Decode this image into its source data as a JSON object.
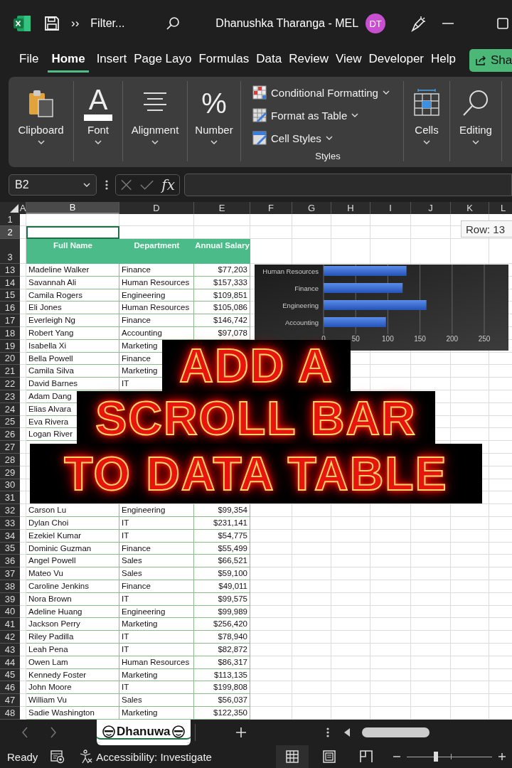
{
  "title_bar": {
    "more": "››",
    "document": "Filter...",
    "user": "Dhanushka Tharanga - MEL",
    "avatar": "DT"
  },
  "menu_tabs": [
    {
      "label": "File",
      "selected": false
    },
    {
      "label": "Home",
      "selected": true
    },
    {
      "label": "Insert",
      "selected": false
    },
    {
      "label": "Page Layo",
      "selected": false
    },
    {
      "label": "Formulas",
      "selected": false
    },
    {
      "label": "Data",
      "selected": false
    },
    {
      "label": "Review",
      "selected": false
    },
    {
      "label": "View",
      "selected": false
    },
    {
      "label": "Developer",
      "selected": false
    },
    {
      "label": "Help",
      "selected": false
    }
  ],
  "share_button": "Sha",
  "ribbon": {
    "groups": [
      {
        "kind": "clipboard",
        "label": "Clipboard"
      },
      {
        "kind": "font",
        "label": "Font",
        "glyph": "A"
      },
      {
        "kind": "alignment",
        "label": "Alignment"
      },
      {
        "kind": "number",
        "label": "Number",
        "glyph": "%"
      },
      {
        "kind": "styles",
        "label": "Styles",
        "items": [
          "Conditional Formatting",
          "Format as Table",
          "Cell Styles"
        ]
      },
      {
        "kind": "cells",
        "label": "Cells"
      },
      {
        "kind": "editing",
        "label": "Editing"
      }
    ]
  },
  "formula_bar": {
    "name_box": "B2",
    "function_label": "fx"
  },
  "sheet": {
    "columns": [
      {
        "label": "A",
        "selected": false
      },
      {
        "label": "B",
        "selected": true
      },
      {
        "label": "D",
        "selected": false
      },
      {
        "label": "E",
        "selected": false
      },
      {
        "label": "F",
        "selected": false
      },
      {
        "label": "G",
        "selected": false
      },
      {
        "label": "H",
        "selected": false
      },
      {
        "label": "I",
        "selected": false
      },
      {
        "label": "J",
        "selected": false
      },
      {
        "label": "K",
        "selected": false
      },
      {
        "label": "L",
        "selected": false
      }
    ],
    "top_rows": [
      {
        "number": "1",
        "selected": false
      },
      {
        "number": "2",
        "selected": true
      },
      {
        "number": "3",
        "selected": false
      }
    ],
    "row_tooltip": "Row: 13"
  },
  "table": {
    "columns": [
      "Full Name",
      "Department",
      "Annual Salary"
    ],
    "rows": [
      {
        "number": "13",
        "cells": [
          "Madeline Walker",
          "Finance",
          "$77,203"
        ]
      },
      {
        "number": "14",
        "cells": [
          "Savannah Ali",
          "Human Resources",
          "$157,333"
        ]
      },
      {
        "number": "15",
        "cells": [
          "Camila Rogers",
          "Engineering",
          "$109,851"
        ]
      },
      {
        "number": "16",
        "cells": [
          "Eli Jones",
          "Human Resources",
          "$105,086"
        ]
      },
      {
        "number": "17",
        "cells": [
          "Everleigh Ng",
          "Finance",
          "$146,742"
        ]
      },
      {
        "number": "18",
        "cells": [
          "Robert Yang",
          "Accounting",
          "$97,078"
        ]
      },
      {
        "number": "19",
        "cells": [
          "Isabella Xi",
          "Marketing"
        ]
      },
      {
        "number": "20",
        "cells": [
          "Bella Powell",
          "Finance"
        ]
      },
      {
        "number": "21",
        "cells": [
          "Camila Silva",
          "Marketing"
        ]
      },
      {
        "number": "22",
        "cells": [
          "David Barnes",
          "IT"
        ]
      },
      {
        "number": "23",
        "cells": [
          "Adam Dang"
        ]
      },
      {
        "number": "24",
        "cells": [
          "Elias Alvara"
        ]
      },
      {
        "number": "25",
        "cells": [
          "Eva Rivera"
        ]
      },
      {
        "number": "26",
        "cells": [
          "Logan River"
        ]
      },
      {
        "number": "27"
      },
      {
        "number": "28"
      },
      {
        "number": "29"
      },
      {
        "number": "30"
      },
      {
        "number": "31"
      },
      {
        "number": "32",
        "cells": [
          "Carson Lu",
          "Engineering",
          "$99,354"
        ]
      },
      {
        "number": "33",
        "cells": [
          "Dylan Choi",
          "IT",
          "$231,141"
        ]
      },
      {
        "number": "34",
        "cells": [
          "Ezekiel Kumar",
          "IT",
          "$54,775"
        ]
      },
      {
        "number": "35",
        "cells": [
          "Dominic Guzman",
          "Finance",
          "$55,499"
        ]
      },
      {
        "number": "36",
        "cells": [
          "Angel Powell",
          "Sales",
          "$66,521"
        ]
      },
      {
        "number": "37",
        "cells": [
          "Mateo Vu",
          "Sales",
          "$59,100"
        ]
      },
      {
        "number": "38",
        "cells": [
          "Caroline Jenkins",
          "Finance",
          "$49,011"
        ]
      },
      {
        "number": "39",
        "cells": [
          "Nora Brown",
          "IT",
          "$99,575"
        ]
      },
      {
        "number": "40",
        "cells": [
          "Adeline Huang",
          "Engineering",
          "$99,989"
        ]
      },
      {
        "number": "41",
        "cells": [
          "Jackson Perry",
          "Marketing",
          "$256,420"
        ]
      },
      {
        "number": "42",
        "cells": [
          "Riley Padilla",
          "IT",
          "$78,940"
        ]
      },
      {
        "number": "43",
        "cells": [
          "Leah Pena",
          "IT",
          "$82,872"
        ]
      },
      {
        "number": "44",
        "cells": [
          "Owen Lam",
          "Human Resources",
          "$86,317"
        ]
      },
      {
        "number": "45",
        "cells": [
          "Kennedy Foster",
          "Marketing",
          "$113,135"
        ]
      },
      {
        "number": "46",
        "cells": [
          "John Moore",
          "IT",
          "$199,808"
        ]
      },
      {
        "number": "47",
        "cells": [
          "William Vu",
          "Sales",
          "$56,037"
        ]
      },
      {
        "number": "48",
        "cells": [
          "Sadie Washington",
          "Marketing",
          "$122,350"
        ]
      }
    ]
  },
  "chart": {
    "chart_data": {
      "type": "bar",
      "orientation": "horizontal",
      "categories": [
        "Human Resources",
        "Finance",
        "Engineering",
        "Accounting"
      ],
      "values": [
        129,
        123,
        160,
        97
      ],
      "xlim": [
        0,
        250
      ],
      "xticks": [
        0,
        50,
        100,
        150,
        200,
        250
      ],
      "grid": true
    }
  },
  "overlay_title": [
    "ADD A",
    "SCROLL BAR",
    "TO DATA TABLE"
  ],
  "sheet_tabs": [
    {
      "label": "Dhanuwa",
      "selected": true
    }
  ],
  "status_bar": {
    "status": "Ready",
    "accessibility": "Accessibility: Investigate",
    "views": [
      {
        "kind": "normal",
        "selected": true
      },
      {
        "kind": "page_layout",
        "selected": false
      },
      {
        "kind": "page_break",
        "selected": false
      }
    ],
    "zoom": {
      "level": 0.34
    }
  }
}
